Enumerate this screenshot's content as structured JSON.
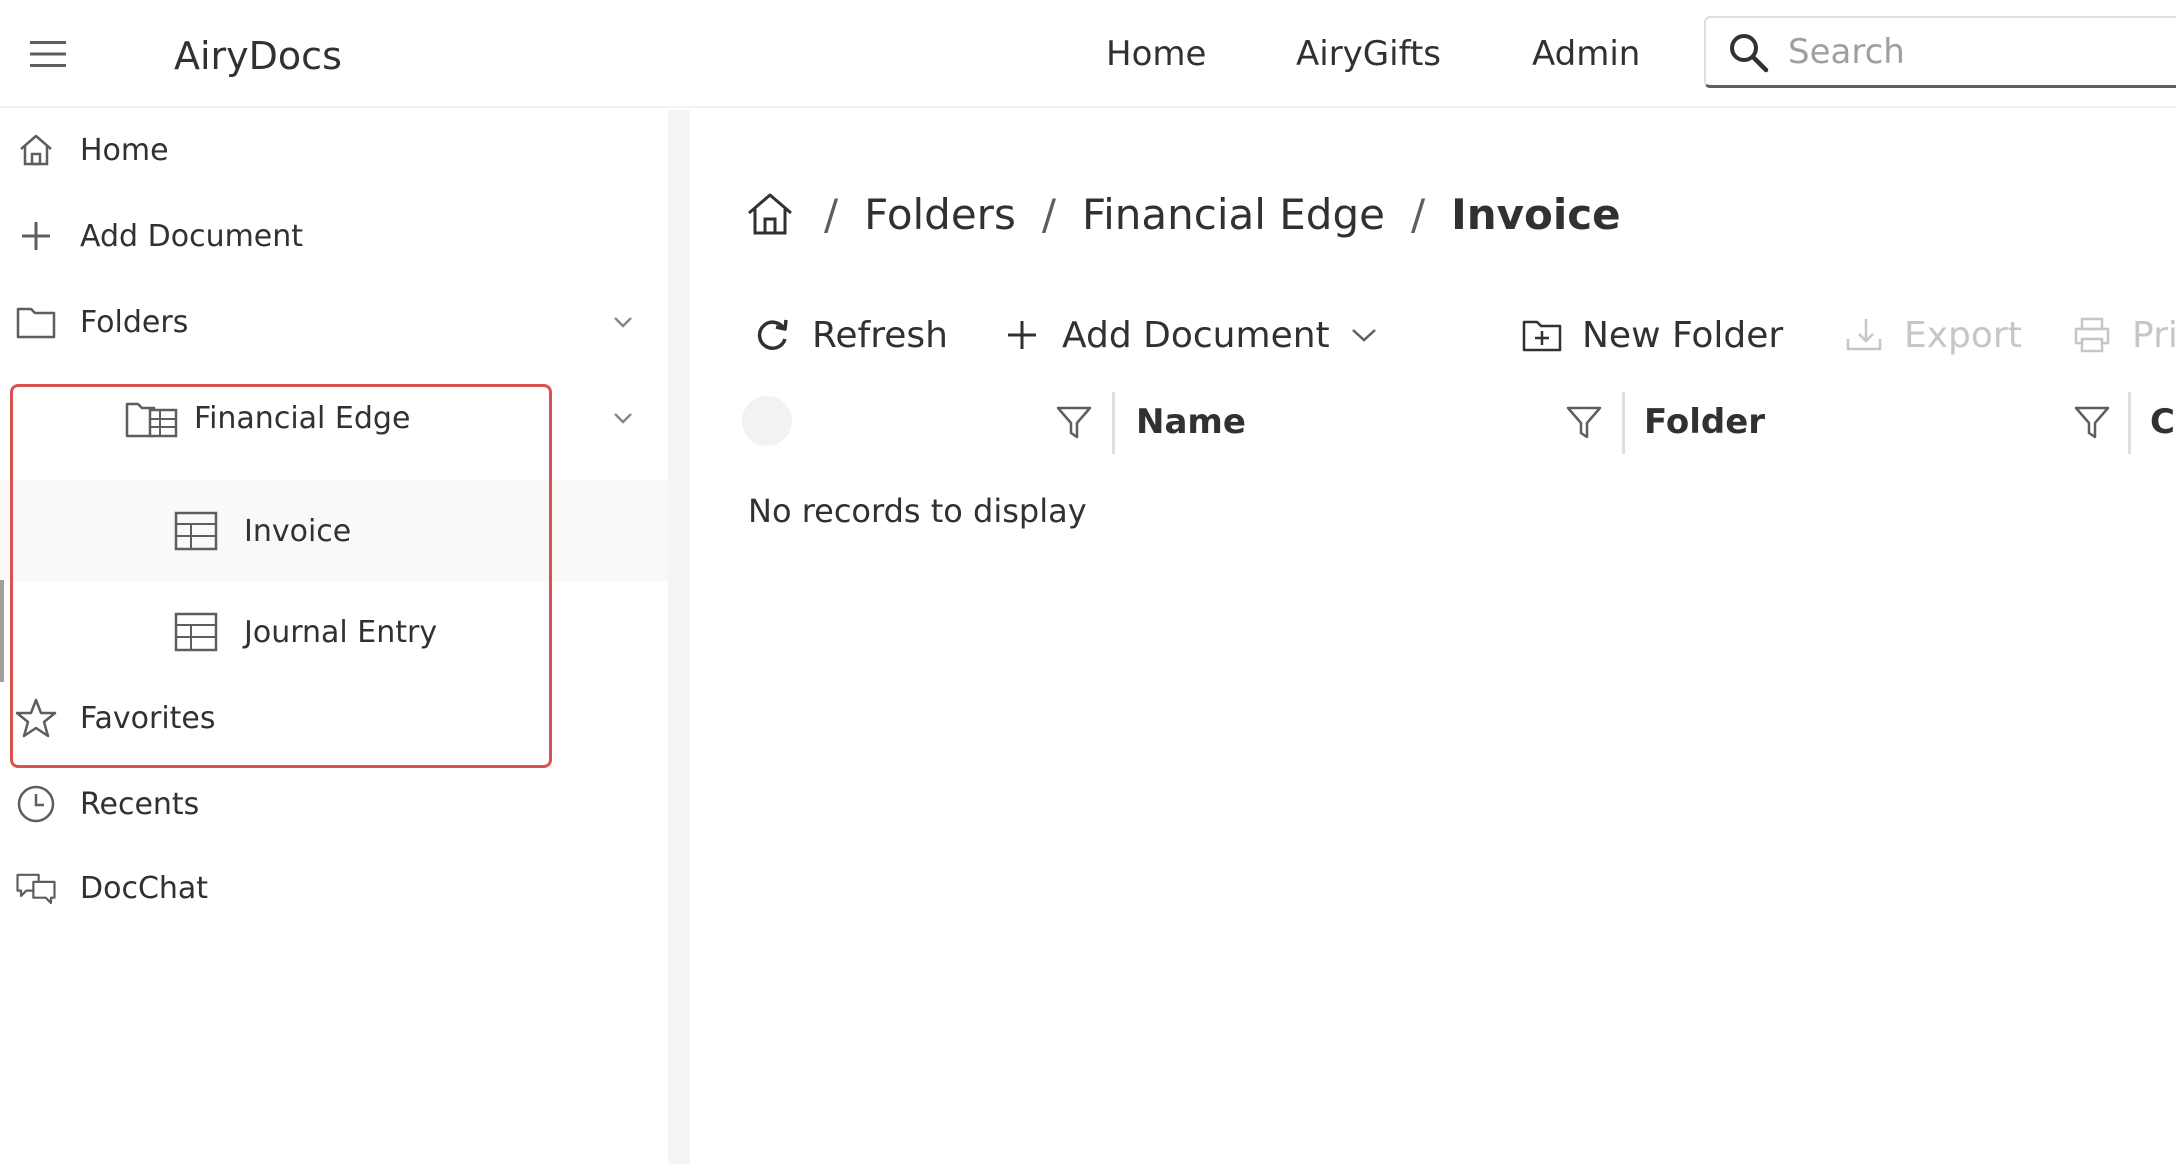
{
  "app": {
    "title": "AiryDocs"
  },
  "topnav": {
    "items": [
      "Home",
      "AiryGifts",
      "Admin"
    ],
    "search_placeholder": "Search"
  },
  "sidebar": {
    "items": [
      {
        "label": "Home",
        "icon": "home-icon"
      },
      {
        "label": "Add Document",
        "icon": "plus-icon"
      },
      {
        "label": "Folders",
        "icon": "folder-icon",
        "expanded": true
      },
      {
        "label": "Financial Edge",
        "icon": "folder-group-icon",
        "expanded": true
      },
      {
        "label": "Invoice",
        "icon": "table-icon",
        "selected": true
      },
      {
        "label": "Journal Entry",
        "icon": "table-icon"
      },
      {
        "label": "Favorites",
        "icon": "star-icon"
      },
      {
        "label": "Recents",
        "icon": "clock-icon"
      },
      {
        "label": "DocChat",
        "icon": "chat-icon"
      }
    ]
  },
  "breadcrumb": {
    "separator": "/",
    "items": [
      "Folders",
      "Financial Edge",
      "Invoice"
    ]
  },
  "toolbar": {
    "refresh": "Refresh",
    "add_document": "Add Document",
    "new_folder": "New Folder",
    "export": "Export",
    "print": "Print"
  },
  "grid": {
    "columns": [
      "Name",
      "Folder",
      "C"
    ],
    "empty_message": "No records to display"
  },
  "colors": {
    "highlight_border": "#d9534f",
    "text": "#323130",
    "disabled_text": "#c8c6c4"
  }
}
